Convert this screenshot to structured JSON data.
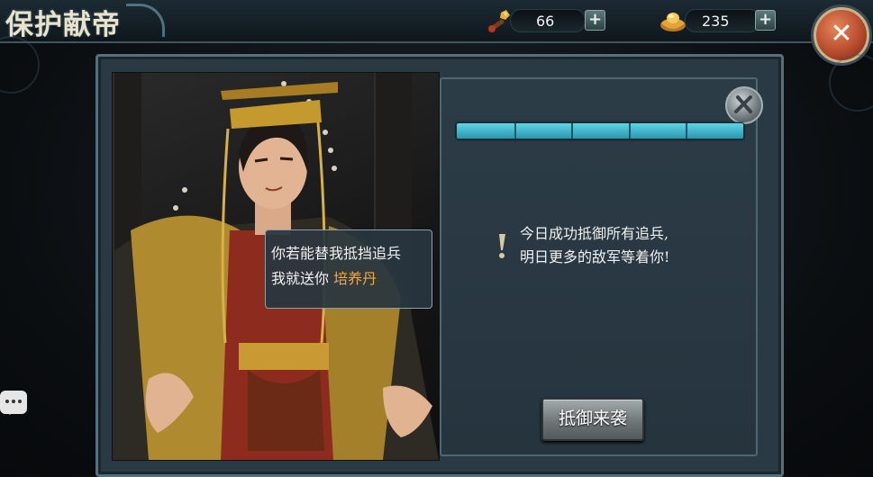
{
  "header": {
    "title": "保护献帝"
  },
  "resources": [
    {
      "name": "stamina",
      "icon": "torch-icon",
      "value": "66"
    },
    {
      "name": "gold",
      "icon": "gold-ingot-icon",
      "value": "235"
    }
  ],
  "dialog": {
    "line1": "你若能替我抵挡追兵",
    "line2_prefix": "我就送你",
    "reward": "培养丹"
  },
  "panel": {
    "progress_segments": 5,
    "progress_fraction": 1.0,
    "message_line1": "今日成功抵御所有追兵,",
    "message_line2": "明日更多的敌军等着你!",
    "action_label": "抵御来袭"
  },
  "colors": {
    "progress_fill": "#4fc3d8",
    "reward_highlight": "#f5a640",
    "close_button": "#c25a35"
  }
}
